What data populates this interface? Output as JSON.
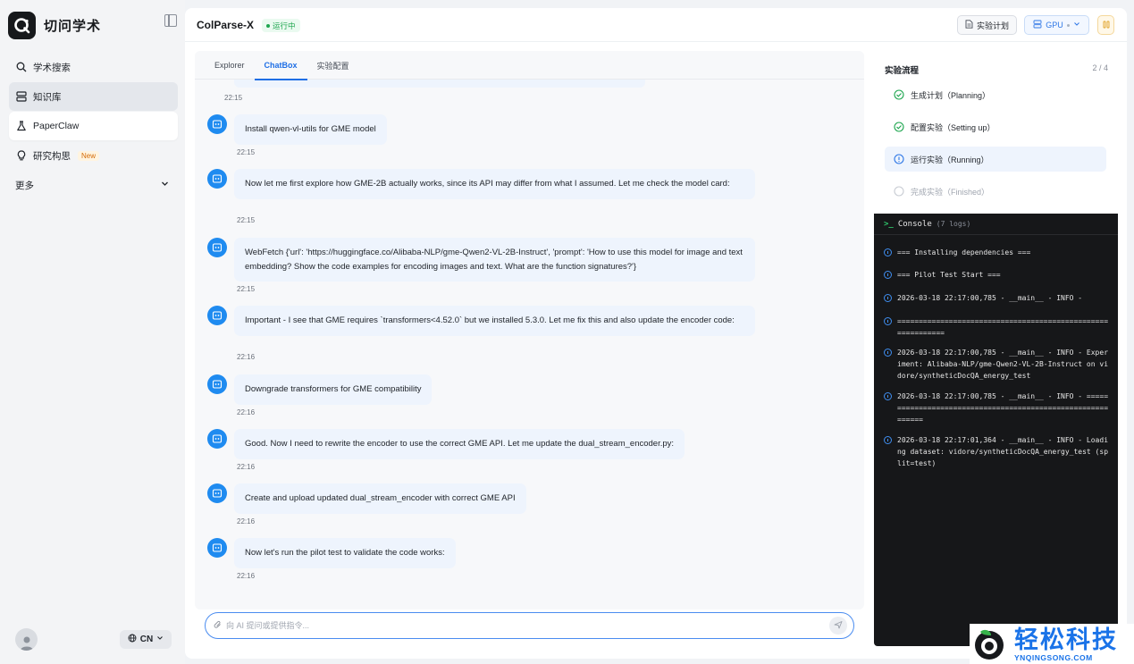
{
  "app": {
    "name": "切问学术"
  },
  "sidebar": {
    "items": [
      {
        "label": "学术搜索",
        "icon": "search-icon"
      },
      {
        "label": "知识库",
        "icon": "database-icon"
      },
      {
        "label": "PaperClaw",
        "icon": "flask-icon"
      },
      {
        "label": "研究构思",
        "icon": "lightbulb-icon",
        "badge": "New"
      }
    ],
    "more_label": "更多",
    "lang_label": "CN"
  },
  "header": {
    "project_title": "ColParse-X",
    "status": "运行中",
    "plan_button": "实验计划",
    "gpu_button": "GPU"
  },
  "chat": {
    "tabs": [
      "Explorer",
      "ChatBox",
      "实验配置"
    ],
    "active_tab": "ChatBox",
    "first_time": "22:15",
    "messages": [
      {
        "text": "Install qwen-vl-utils for GME model",
        "time": "22:15"
      },
      {
        "text": "Now let me first explore how GME-2B actually works, since its API may differ from what I assumed. Let me check the model card:",
        "time": "22:15"
      },
      {
        "text": "WebFetch {'url': 'https://huggingface.co/Alibaba-NLP/gme-Qwen2-VL-2B-Instruct', 'prompt': 'How to use this model for image and text embedding? Show the code examples for encoding images and text. What are the function signatures?'}",
        "time": "22:15"
      },
      {
        "text": "Important - I see that GME requires `transformers<4.52.0` but we installed 5.3.0. Let me fix this and also update the encoder code:",
        "time": "22:16"
      },
      {
        "text": "Downgrade transformers for GME compatibility",
        "time": "22:16"
      },
      {
        "text": "Good. Now I need to rewrite the encoder to use the correct GME API. Let me update the dual_stream_encoder.py:",
        "time": "22:16"
      },
      {
        "text": "Create and upload updated dual_stream_encoder with correct GME API",
        "time": "22:16"
      },
      {
        "text": "Now let's run the pilot test to validate the code works:",
        "time": "22:16"
      }
    ],
    "input_placeholder": "向 AI 提问或提供指令..."
  },
  "flow": {
    "title": "实验流程",
    "progress": "2 / 4",
    "steps": [
      {
        "label": "生成计划（Planning）",
        "state": "done"
      },
      {
        "label": "配置实验（Setting up）",
        "state": "done"
      },
      {
        "label": "运行实验（Running）",
        "state": "running"
      },
      {
        "label": "完成实验（Finished）",
        "state": "pending"
      }
    ]
  },
  "console": {
    "title": "Console",
    "count": "(7 logs)",
    "logs": [
      "=== Installing dependencies ===",
      "=== Pilot Test Start ===",
      "2026-03-18 22:17:00,785 - __main__ - INFO -",
      "============================================================",
      "2026-03-18 22:17:00,785 - __main__ - INFO - Experiment: Alibaba-NLP/gme-Qwen2-VL-2B-Instruct on vidore/syntheticDocQA_energy_test",
      "2026-03-18 22:17:00,785 - __main__ - INFO - ============================================================",
      "2026-03-18 22:17:01,364 - __main__ - INFO - Loading dataset: vidore/syntheticDocQA_energy_test (split=test)"
    ]
  },
  "watermark": {
    "title": "轻松科技",
    "url": "YNQINGSONG.COM"
  },
  "colors": {
    "accent": "#1f6fe5",
    "success": "#1ea64f",
    "console_bg": "#161719",
    "bubble": "#eef4fd"
  }
}
